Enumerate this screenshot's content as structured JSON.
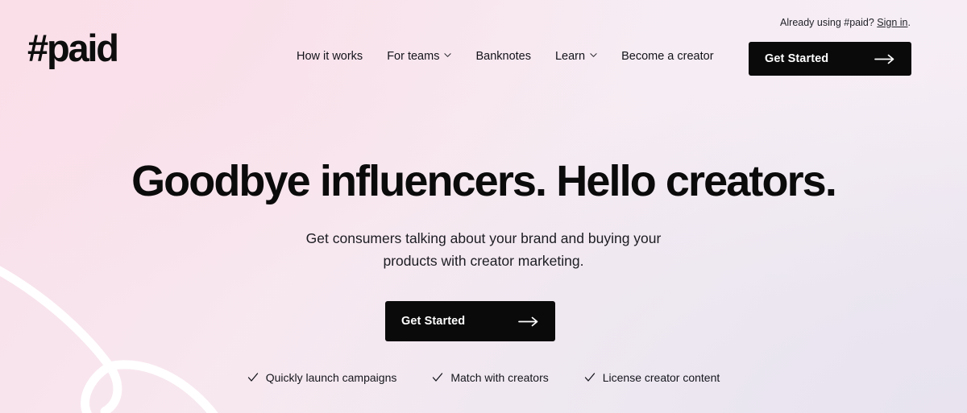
{
  "brand": {
    "logo": "#paid"
  },
  "header": {
    "nav": [
      {
        "label": "How it works",
        "icon": null
      },
      {
        "label": "For teams",
        "icon": "chevron-down-icon"
      },
      {
        "label": "Banknotes",
        "icon": null
      },
      {
        "label": "Learn",
        "icon": "chevron-down-icon"
      },
      {
        "label": "Become a creator",
        "icon": null
      }
    ],
    "signin_prefix": "Already using #paid?",
    "signin_link": "Sign in",
    "signin_suffix": ".",
    "cta_label": "Get Started",
    "cta_icon": "arrow-right-icon"
  },
  "hero": {
    "headline": "Goodbye influencers. Hello creators.",
    "subheadline": "Get consumers talking about your brand and buying your products with creator marketing.",
    "cta_label": "Get Started",
    "cta_icon": "arrow-right-icon",
    "features": [
      {
        "label": "Quickly launch campaigns",
        "icon": "check-icon"
      },
      {
        "label": "Match with creators",
        "icon": "check-icon"
      },
      {
        "label": "License creator content",
        "icon": "check-icon"
      }
    ]
  },
  "colors": {
    "background_top_left": "#fadfe9",
    "background_top_right": "#f7eef5",
    "background_bottom_right": "#ece7f1",
    "button": "#0a0a0a",
    "button_text": "#ffffff",
    "text": "#0b0b0b",
    "decoration": "#ffffff"
  }
}
